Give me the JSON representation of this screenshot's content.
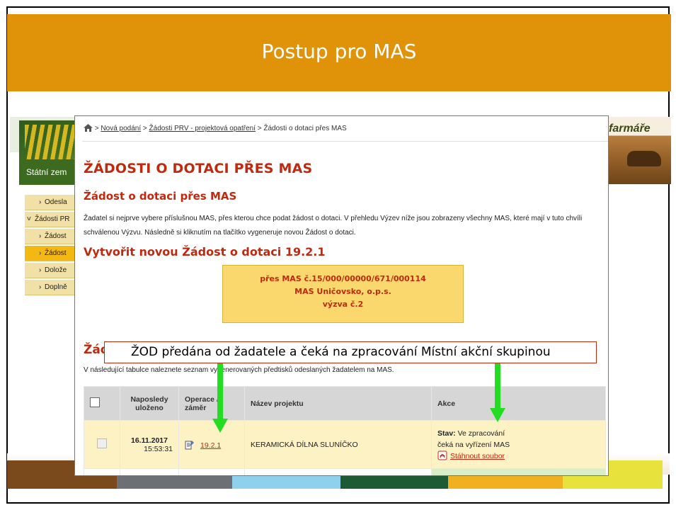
{
  "slide": {
    "title": "Postup pro MAS"
  },
  "background_site": {
    "org_name": "Státní zem",
    "brand_word": "farmáře",
    "side_menu": [
      {
        "label": "Odesla",
        "state": "normal"
      },
      {
        "label": "Žádosti PR",
        "state": "open"
      },
      {
        "label": "Žádost",
        "state": "normal"
      },
      {
        "label": "Žádost",
        "state": "active"
      },
      {
        "label": "Dolože",
        "state": "normal"
      },
      {
        "label": "Doplně",
        "state": "normal"
      }
    ],
    "footer_stripes": [
      "#7a4a1c",
      "#6c6f73",
      "#8fd1ec",
      "#1e5a34",
      "#f0b020",
      "#e8e23c"
    ]
  },
  "window": {
    "breadcrumb": {
      "sep": ">",
      "items": [
        "Nová podání",
        "Žádosti PRV - projektová opatření",
        "Žádosti o dotaci přes MAS"
      ]
    },
    "page_title": "ŽÁDOSTI O DOTACI PŘES MAS",
    "section_title": "Žádost o dotaci přes MAS",
    "intro_text": "Žadatel si nejprve vybere příslušnou MAS, přes kterou chce podat žádost o dotaci. V přehledu Výzev níže jsou zobrazeny všechny MAS, které mají v tuto chvíli schválenou Výzvu. Následně si kliknutím na tlačítko vygeneruje novou Žádost o dotaci.",
    "create_title": "Vytvořit novou Žádost o dotaci 19.2.1",
    "mas_button": {
      "line1": "přes MAS č.15/000/00000/671/000114",
      "line2": "MAS Uničovsko, o.p.s.",
      "line3": "výzva č.2"
    },
    "list_title_partial": "Žád",
    "list_text": "V následující tabulce naleznete seznam vygenerovaných předtisků odeslaných žadatelem na MAS.",
    "table": {
      "headers": {
        "saved": "Naposledy uloženo",
        "operation": "Operace / záměr",
        "project": "Název projektu",
        "actions": "Akce"
      },
      "rows": [
        {
          "date": "16.11.2017",
          "time": "15:53:31",
          "operation": "19.2.1",
          "project": "KERAMICKÁ DÍLNA SLUNÍČKO",
          "status_label": "Stav:",
          "status_value": "Ve zpracování",
          "status_detail": "čeká na vyřízení MAS",
          "download": "Stáhnout soubor"
        }
      ]
    }
  },
  "callout": {
    "text": "ŽOD předána od žadatele a čeká na zpracování Místní akční skupinou"
  },
  "colors": {
    "title_bar": "#e09208",
    "heading": "#c0290e",
    "mas_button": "#fbd86e",
    "row_highlight": "#fdf2c4",
    "arrow": "#22dd22"
  }
}
